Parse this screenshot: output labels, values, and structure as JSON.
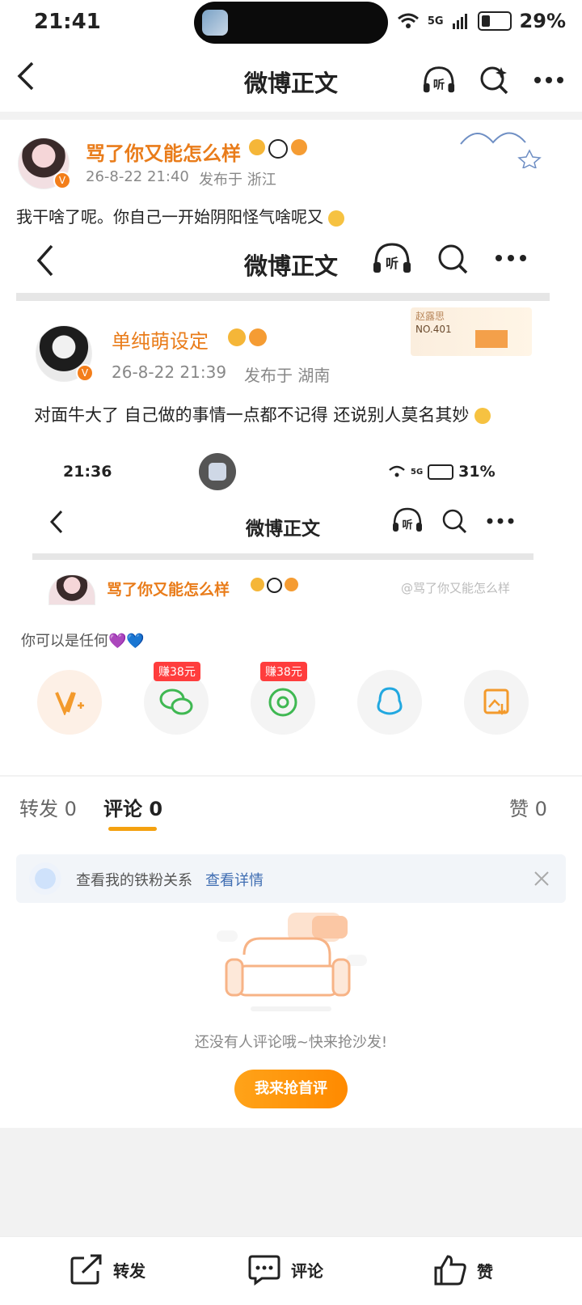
{
  "status_bar": {
    "time": "21:41",
    "network": "5G",
    "battery": "29%"
  },
  "navbar": {
    "title": "微博正文",
    "listen_label": "听"
  },
  "post": {
    "username": "骂了你又能怎么样",
    "time": "26-8-22 21:40",
    "location": "发布于 浙江",
    "text": "我干啥了呢。你自己一开始阴阳怪气啥呢又"
  },
  "embedded_shot": {
    "nav_title": "微博正文",
    "listen_label": "听",
    "username": "单纯萌设定",
    "time": "26-8-22 21:39",
    "location": "发布于 湖南",
    "text": "对面牛大了 自己做的事情一点都不记得 还说别人莫名其妙",
    "badge_name": "赵露思",
    "badge_no": "NO.401",
    "inner_status": {
      "time": "21:36",
      "network": "5G",
      "battery": "31%"
    },
    "inner_nav_title": "微博正文",
    "inner_listen_label": "听",
    "inner_username": "骂了你又能怎么样",
    "watermark": "@骂了你又能怎么样"
  },
  "share": {
    "caption": "你可以是任何💜💙",
    "earn_1": "赚38元",
    "earn_2": "赚38元"
  },
  "tabs": {
    "repost": "转发 0",
    "comment": "评论 0",
    "like": "赞 0"
  },
  "comments": {
    "fans_text": "查看我的铁粉关系",
    "fans_link": "查看详情",
    "empty_text": "还没有人评论哦~快来抢沙发!",
    "first_button": "我来抢首评"
  },
  "bottom_bar": {
    "repost": "转发",
    "comment": "评论",
    "like": "赞"
  },
  "colors": {
    "accent": "#f4a10f",
    "username": "#e97c1a",
    "earn": "#ff3d3d"
  }
}
